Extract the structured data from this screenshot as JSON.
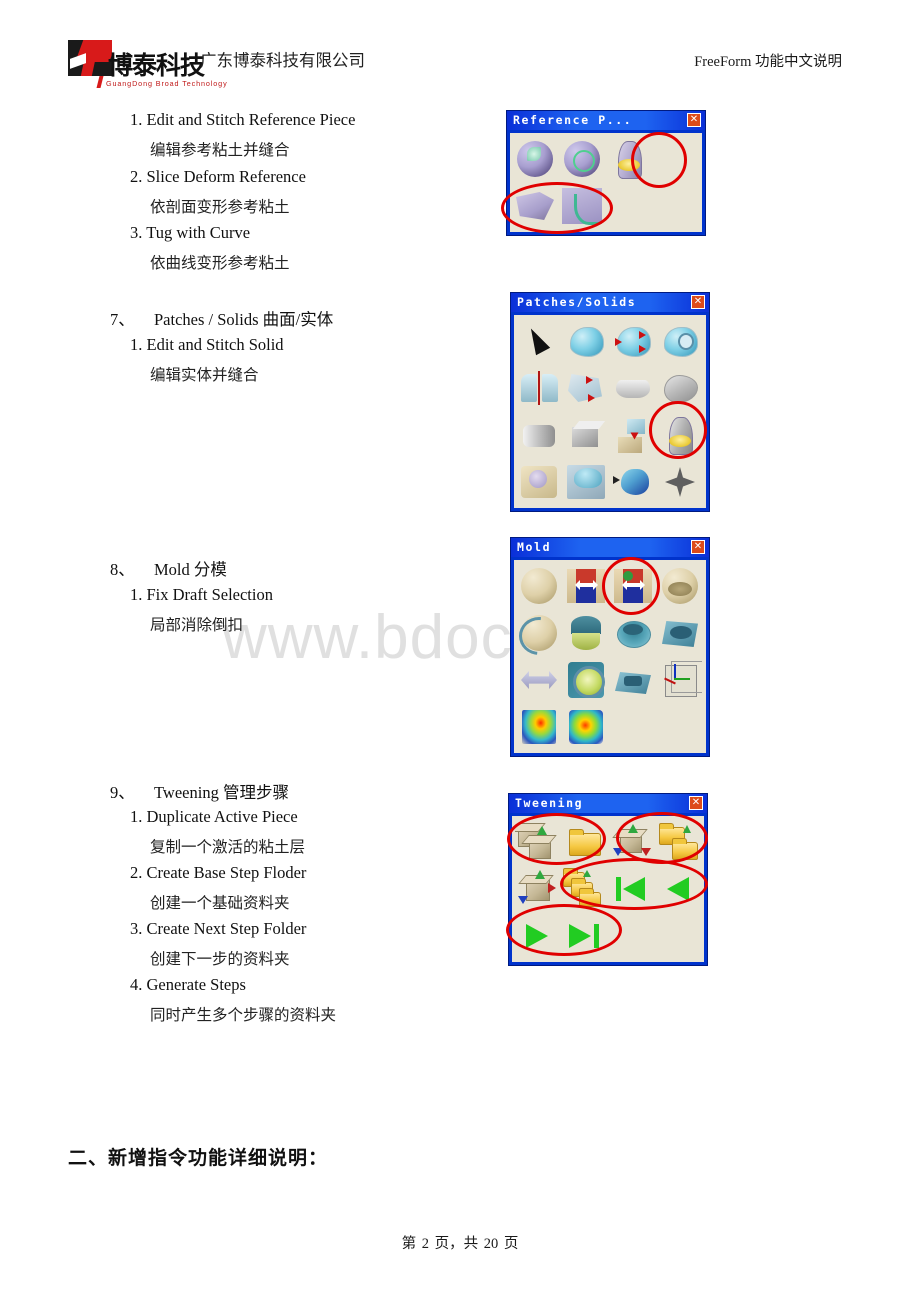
{
  "document": {
    "header": {
      "logo_cn": "博泰科技",
      "logo_en": "GuangDong Broad Technology",
      "company_name": "广东博泰科技有限公司",
      "right_title": "FreeForm 功能中文说明"
    },
    "watermark": "www.bdocx.com",
    "footer": {
      "prefix": "第",
      "page": "2",
      "mid": "页，共",
      "total": "20",
      "suffix": "页"
    },
    "section2_title": "二、新增指令功能详细说明："
  },
  "content": {
    "reference_items": [
      {
        "num": "1.",
        "en": "Edit and Stitch Reference Piece",
        "cn": "编辑参考粘土并缝合"
      },
      {
        "num": "2.",
        "en": "Slice Deform Reference",
        "cn": "依剖面变形参考粘土"
      },
      {
        "num": "3.",
        "en": "Tug with Curve",
        "cn": "依曲线变形参考粘土"
      }
    ],
    "sections": [
      {
        "num": "7、",
        "title": "Patches / Solids 曲面/实体",
        "items": [
          {
            "num": "1.",
            "en": "Edit and Stitch Solid",
            "cn": "编辑实体并缝合"
          }
        ]
      },
      {
        "num": "8、",
        "title": "Mold 分模",
        "items": [
          {
            "num": "1.",
            "en": "Fix Draft Selection",
            "cn": "局部消除倒扣"
          }
        ]
      },
      {
        "num": "9、",
        "title": "Tweening 管理步骤",
        "items": [
          {
            "num": "1.",
            "en": "Duplicate Active Piece",
            "cn": "复制一个激活的粘土层"
          },
          {
            "num": "2.",
            "en": "Create Base Step Floder",
            "cn": "创建一个基础资料夹"
          },
          {
            "num": "3.",
            "en": "Create Next Step Folder",
            "cn": "创建下一步的资料夹"
          },
          {
            "num": "4.",
            "en": "Generate Steps",
            "cn": "同时产生多个步骤的资料夹"
          }
        ]
      }
    ]
  },
  "panels": [
    {
      "id": "reference-piece",
      "title": "Reference P...",
      "close_label": "✕",
      "rows": [
        3,
        2
      ],
      "annotations": 2
    },
    {
      "id": "patches-solids",
      "title": "Patches/Solids",
      "close_label": "✕",
      "rows": [
        4,
        4,
        4,
        4
      ],
      "annotations": 1
    },
    {
      "id": "mold",
      "title": "Mold",
      "close_label": "✕",
      "rows": [
        4,
        4,
        4,
        2
      ],
      "annotations": 1
    },
    {
      "id": "tweening",
      "title": "Tweening",
      "close_label": "✕",
      "rows": [
        4,
        4,
        2
      ],
      "annotations": 4
    }
  ],
  "colors": {
    "panel_titlebar": "#1e63f0",
    "panel_border": "#0033cc",
    "panel_body": "#e9e5d6",
    "annotation": "#e00000",
    "close_button": "#dd4b1a",
    "logo_red": "#d81a1a",
    "watermark": "#e0e0e0"
  }
}
